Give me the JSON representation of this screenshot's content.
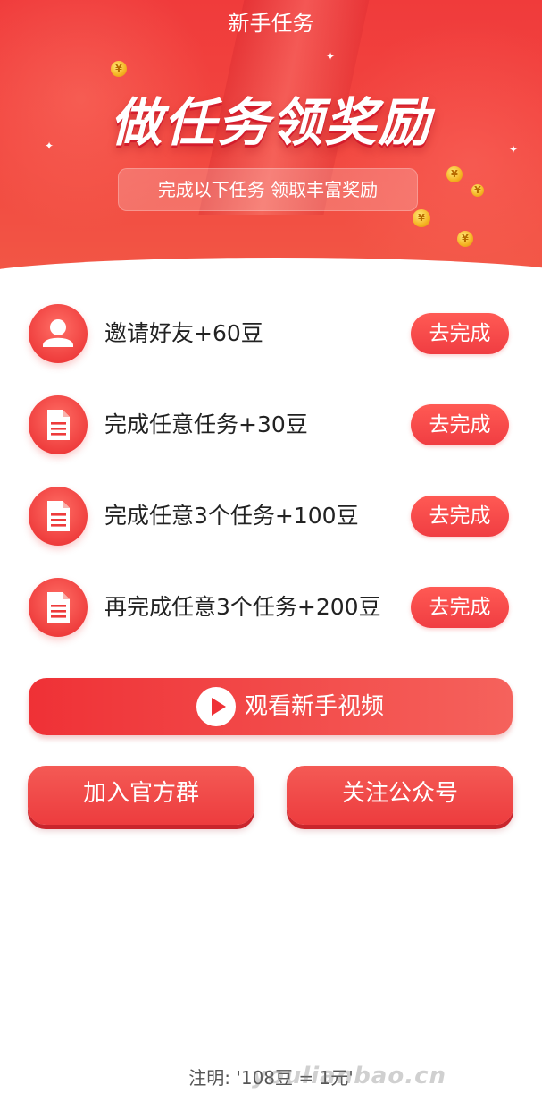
{
  "header": {
    "title": "新手任务",
    "heading": "做任务领奖励",
    "subtitle": "完成以下任务 领取丰富奖励"
  },
  "tasks": [
    {
      "label": "邀请好友+60豆",
      "button": "去完成",
      "icon": "user-icon"
    },
    {
      "label": "完成任意任务+30豆",
      "button": "去完成",
      "icon": "document-icon"
    },
    {
      "label": "完成任意3个任务+100豆",
      "button": "去完成",
      "icon": "document-icon"
    },
    {
      "label": "再完成任意3个任务+200豆",
      "button": "去完成",
      "icon": "document-icon"
    }
  ],
  "video": {
    "label": "观看新手视频",
    "icon": "play-icon"
  },
  "actions": {
    "join_group": "加入官方群",
    "follow_account": "关注公众号"
  },
  "footer": {
    "note": "注明: '108豆 = 1元'",
    "watermark": "youlianbao.cn"
  },
  "colors": {
    "primary": "#f03d42",
    "hero_bg": "#f03b3b",
    "text": "#222222"
  }
}
